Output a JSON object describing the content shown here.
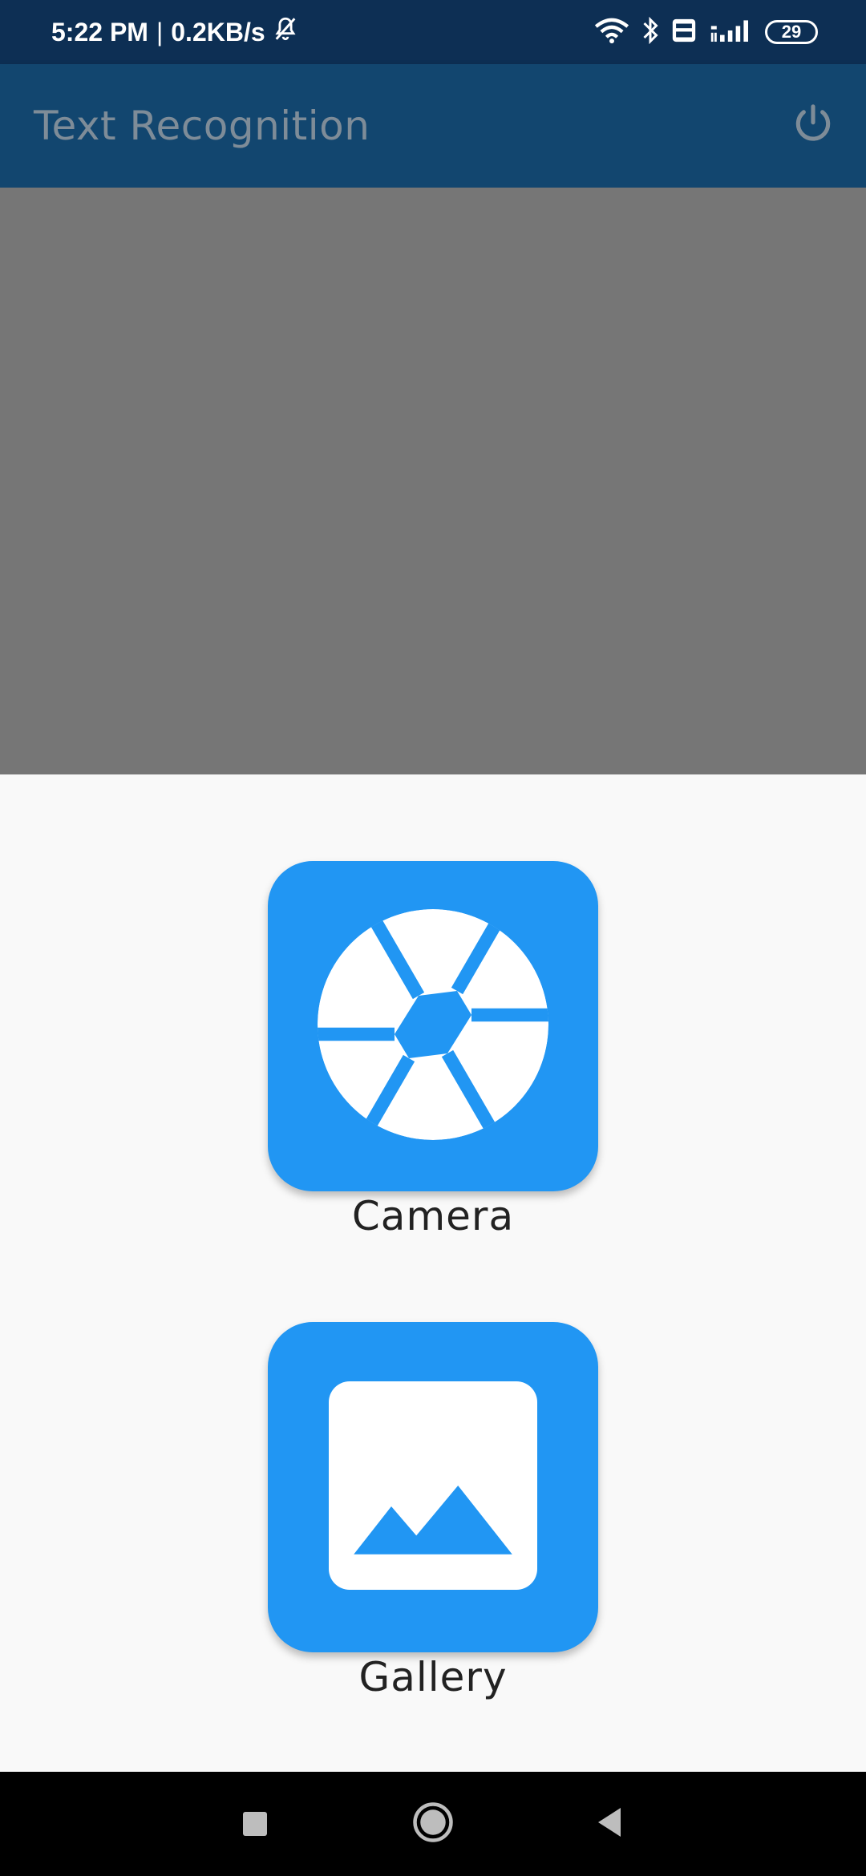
{
  "status_bar": {
    "time": "5:22 PM",
    "separator": "|",
    "network_speed": "0.2KB/s",
    "battery": "29",
    "icons": [
      "mute-icon",
      "wifi-icon",
      "bluetooth-icon",
      "volte-icon",
      "signal-4g-icon",
      "battery-icon"
    ]
  },
  "app_bar": {
    "title": "Text Recognition",
    "power_icon": "power-icon"
  },
  "actions": {
    "camera_label": "Camera",
    "gallery_label": "Gallery"
  },
  "colors": {
    "status_bar": "#0d2f54",
    "app_bar": "#12466f",
    "accent": "#2196f3",
    "preview": "#767676",
    "background": "#f9f9f9"
  }
}
